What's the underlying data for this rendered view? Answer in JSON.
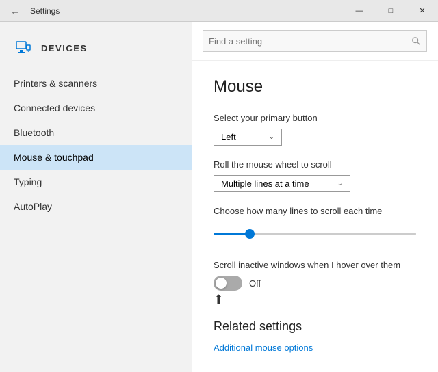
{
  "titlebar": {
    "title": "Settings",
    "minimize_label": "—",
    "maximize_label": "□",
    "close_label": "✕"
  },
  "sidebar": {
    "header": {
      "icon": "⚙",
      "title": "DEVICES"
    },
    "search_placeholder": "Find a setting",
    "items": [
      {
        "id": "printers",
        "label": "Printers & scanners",
        "active": false
      },
      {
        "id": "connected",
        "label": "Connected devices",
        "active": false
      },
      {
        "id": "bluetooth",
        "label": "Bluetooth",
        "active": false
      },
      {
        "id": "mouse",
        "label": "Mouse & touchpad",
        "active": true
      },
      {
        "id": "typing",
        "label": "Typing",
        "active": false
      },
      {
        "id": "autoplay",
        "label": "AutoPlay",
        "active": false
      }
    ]
  },
  "main": {
    "title": "Mouse",
    "primary_button": {
      "label": "Select your primary button",
      "value": "Left"
    },
    "scroll_wheel": {
      "label": "Roll the mouse wheel to scroll",
      "value": "Multiple lines at a time"
    },
    "scroll_lines": {
      "label": "Choose how many lines to scroll each time",
      "slider_percent": 18
    },
    "inactive_scroll": {
      "label": "Scroll inactive windows when I hover over them",
      "state": "Off",
      "enabled": false
    },
    "related_settings": {
      "title": "Related settings",
      "link_label": "Additional mouse options"
    }
  }
}
